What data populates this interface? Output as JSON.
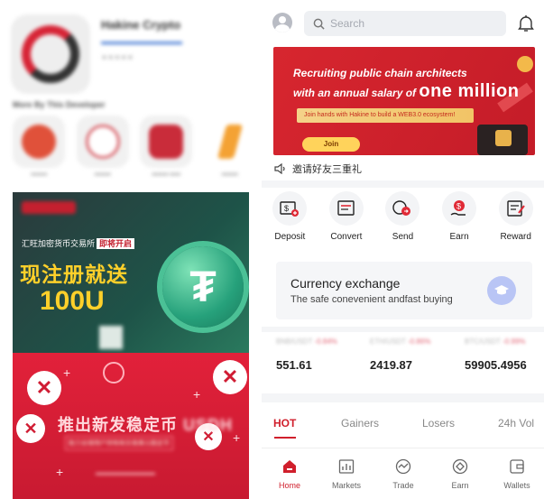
{
  "right": {
    "search": {
      "placeholder": "Search"
    },
    "banner": {
      "line1": "Recruiting public chain architects",
      "line2_prefix": "with an annual salary of ",
      "line2_emph": "one million",
      "strip": "Join hands with Hakine to build a WEB3.0 ecosystem!",
      "join": "Join"
    },
    "notice": "邀请好友三重礼",
    "actions": [
      {
        "label": "Deposit",
        "icon": "deposit-icon"
      },
      {
        "label": "Convert",
        "icon": "convert-icon"
      },
      {
        "label": "Send",
        "icon": "send-icon"
      },
      {
        "label": "Earn",
        "icon": "earn-icon"
      },
      {
        "label": "Reward",
        "icon": "reward-icon"
      }
    ],
    "exchange": {
      "title": "Currency exchange",
      "subtitle": "The safe conevenient andfast buying"
    },
    "tickers": [
      {
        "pair": "BNB/USDT",
        "change": "-0.84%",
        "price": "551.61"
      },
      {
        "pair": "ETH/USDT",
        "change": "-0.86%",
        "price": "2419.87"
      },
      {
        "pair": "BTC/USDT",
        "change": "-0.99%",
        "price": "59905.4956"
      }
    ],
    "tabs": [
      "HOT",
      "Gainers",
      "Losers",
      "24h Vol"
    ],
    "nav": [
      {
        "label": "Home",
        "icon": "home-icon"
      },
      {
        "label": "Markets",
        "icon": "markets-icon"
      },
      {
        "label": "Trade",
        "icon": "trade-icon"
      },
      {
        "label": "Earn",
        "icon": "earn-nav-icon"
      },
      {
        "label": "Wallets",
        "icon": "wallet-icon"
      }
    ],
    "accent": "#d01f2c"
  },
  "left": {
    "app_name": "Hakine Crypto",
    "more_by": "More By This Developer",
    "promo1": {
      "tag": "汇旺加密货币交易所",
      "tag_badge": "即将开启",
      "headline": "现注册就送",
      "amount": "100U"
    },
    "promo2": {
      "caption_a": "推出新发稳定币",
      "caption_b": "USDH",
      "sub": "助力全球用户持有和交易美元稳定币"
    }
  }
}
